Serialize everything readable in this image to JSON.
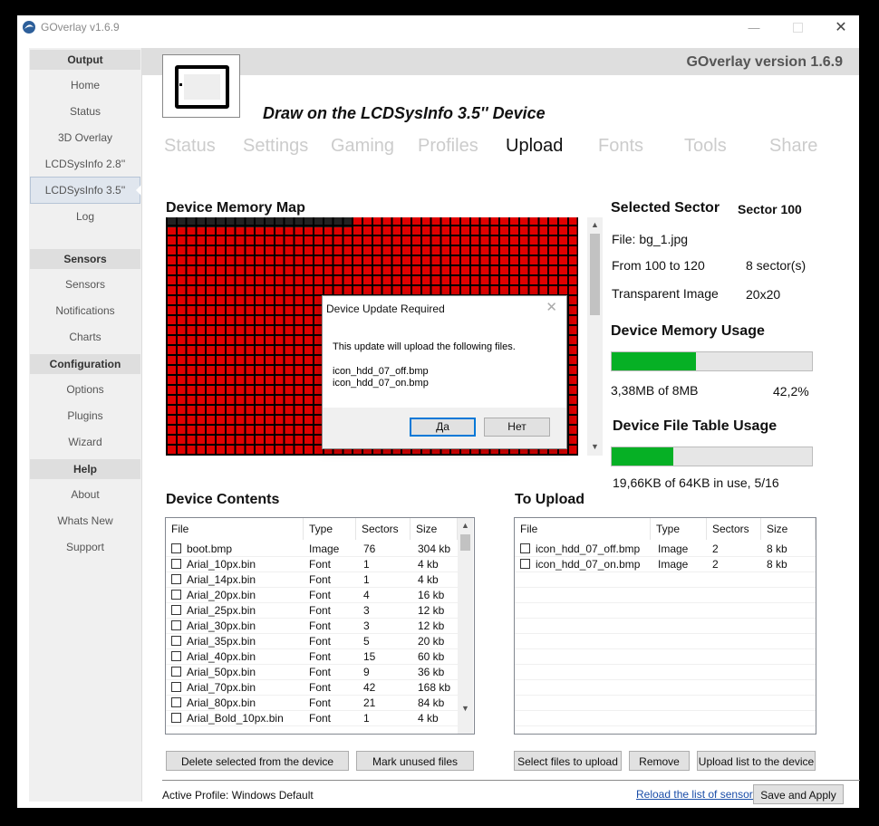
{
  "window": {
    "title": "GOverlay v1.6.9"
  },
  "header": {
    "version": "GOverlay version 1.6.9",
    "subtitle": "Draw on the LCDSysInfo 3.5'' Device"
  },
  "sidebar": {
    "sections": [
      {
        "title": "Output",
        "items": [
          "Home",
          "Status",
          "3D Overlay",
          "LCDSysInfo 2.8''",
          "LCDSysInfo 3.5''",
          "Log"
        ]
      },
      {
        "title": "Sensors",
        "items": [
          "Sensors",
          "Notifications",
          "Charts"
        ]
      },
      {
        "title": "Configuration",
        "items": [
          "Options",
          "Plugins",
          "Wizard"
        ]
      },
      {
        "title": "Help",
        "items": [
          "About",
          "Whats New",
          "Support"
        ]
      }
    ],
    "active": "LCDSysInfo 3.5''"
  },
  "tabs": [
    "Status",
    "Settings",
    "Gaming",
    "Profiles",
    "Upload",
    "Fonts",
    "Tools",
    "Share"
  ],
  "active_tab": "Upload",
  "memory_map": {
    "title": "Device Memory Map",
    "used_cells_first_row": 19,
    "color_used": "#000000",
    "color_free": "#e00000"
  },
  "selected_sector": {
    "title": "Selected Sector",
    "value": "Sector 100",
    "file": "File: bg_1.jpg",
    "range": "From 100 to 120",
    "sectors": "8 sector(s)",
    "transparent_label": "Transparent Image",
    "transparent_value": "20x20"
  },
  "memory_usage": {
    "title": "Device Memory Usage",
    "text": "3,38MB of 8MB",
    "percent_text": "42,2%",
    "fraction": 0.422
  },
  "file_table_usage": {
    "title": "Device File Table Usage",
    "text": "19,66KB of 64KB in use, 5/16",
    "fraction": 0.307
  },
  "device_contents": {
    "title": "Device Contents",
    "columns": [
      "File",
      "Type",
      "Sectors",
      "Size"
    ],
    "rows": [
      [
        "boot.bmp",
        "Image",
        "76",
        "304 kb"
      ],
      [
        "Arial_10px.bin",
        "Font",
        "1",
        "4 kb"
      ],
      [
        "Arial_14px.bin",
        "Font",
        "1",
        "4 kb"
      ],
      [
        "Arial_20px.bin",
        "Font",
        "4",
        "16 kb"
      ],
      [
        "Arial_25px.bin",
        "Font",
        "3",
        "12 kb"
      ],
      [
        "Arial_30px.bin",
        "Font",
        "3",
        "12 kb"
      ],
      [
        "Arial_35px.bin",
        "Font",
        "5",
        "20 kb"
      ],
      [
        "Arial_40px.bin",
        "Font",
        "15",
        "60 kb"
      ],
      [
        "Arial_50px.bin",
        "Font",
        "9",
        "36 kb"
      ],
      [
        "Arial_70px.bin",
        "Font",
        "42",
        "168 kb"
      ],
      [
        "Arial_80px.bin",
        "Font",
        "21",
        "84 kb"
      ],
      [
        "Arial_Bold_10px.bin",
        "Font",
        "1",
        "4 kb"
      ]
    ]
  },
  "to_upload": {
    "title": "To Upload",
    "columns": [
      "File",
      "Type",
      "Sectors",
      "Size"
    ],
    "rows": [
      [
        "icon_hdd_07_off.bmp",
        "Image",
        "2",
        "8 kb"
      ],
      [
        "icon_hdd_07_on.bmp",
        "Image",
        "2",
        "8 kb"
      ]
    ]
  },
  "buttons": {
    "delete": "Delete selected from the device",
    "mark_unused": "Mark unused files",
    "select_files": "Select files to upload",
    "remove": "Remove",
    "upload_list": "Upload list to the device",
    "save_apply": "Save and Apply"
  },
  "footer": {
    "active_profile": "Active Profile: Windows Default",
    "reload_link": "Reload the list of sensors"
  },
  "dialog": {
    "title": "Device Update Required",
    "message": "This update will upload the following files.",
    "files": [
      "icon_hdd_07_off.bmp",
      "icon_hdd_07_on.bmp"
    ],
    "yes": "Да",
    "no": "Нет"
  }
}
